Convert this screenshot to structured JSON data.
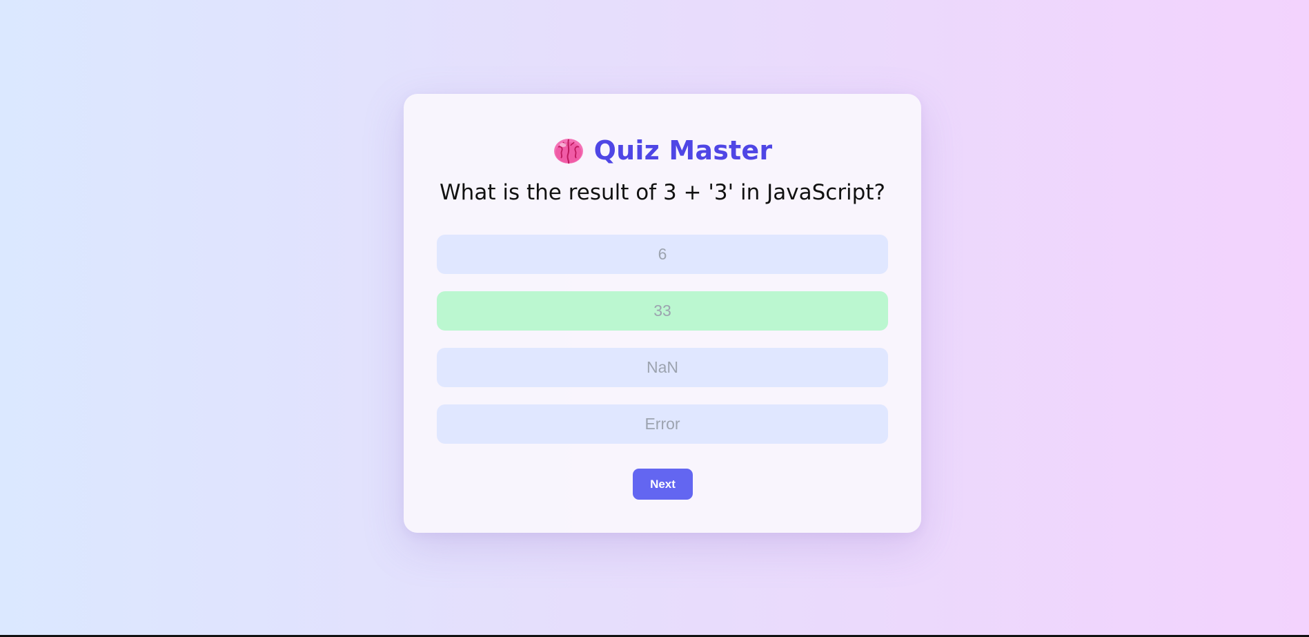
{
  "app": {
    "title": "Quiz Master",
    "icon": "brain-icon",
    "accent_color": "#4f46e5"
  },
  "quiz": {
    "question": "What is the result of 3 + '3' in JavaScript?",
    "options": [
      {
        "label": "6",
        "state": "disabled"
      },
      {
        "label": "33",
        "state": "correct"
      },
      {
        "label": "NaN",
        "state": "disabled"
      },
      {
        "label": "Error",
        "state": "disabled"
      }
    ],
    "correct_color": "#bbf7d0",
    "option_color": "#e0e7ff"
  },
  "controls": {
    "next_label": "Next",
    "next_color": "#6366f1"
  }
}
